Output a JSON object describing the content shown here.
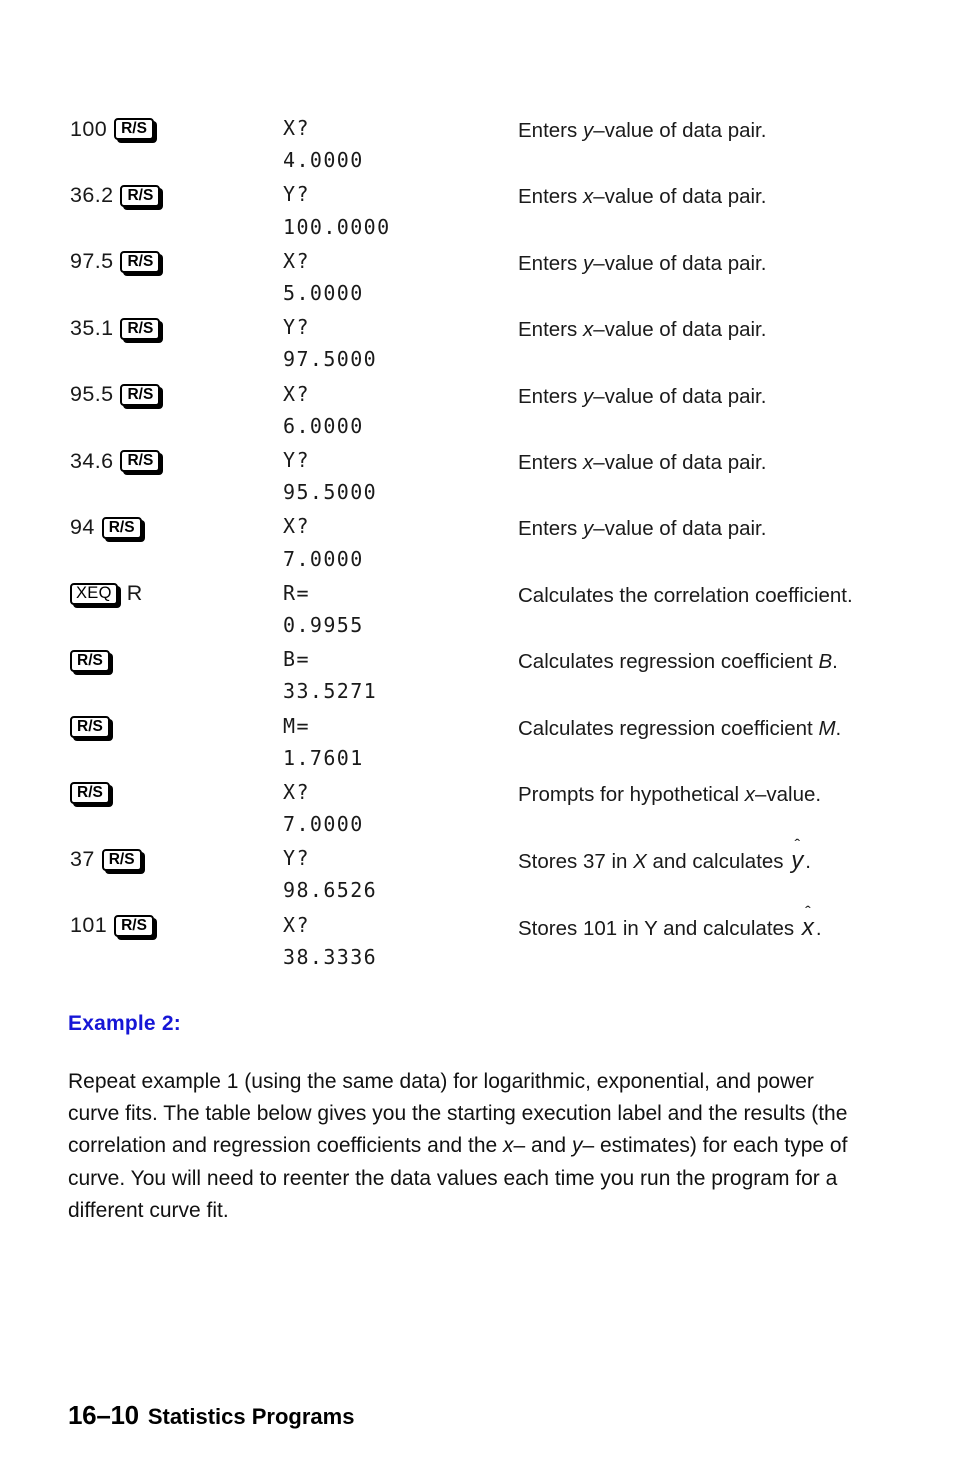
{
  "page": {
    "footer_page_number": "16–10",
    "footer_title": "Statistics Programs"
  },
  "keystroke_table": {
    "rows": [
      {
        "number": "100",
        "key": "R/S",
        "key_style": "bold",
        "suffix": "",
        "display_line1": "X?",
        "display_line2": "4.0000",
        "description_pre": "Enters ",
        "description_var": "y",
        "description_post": "–value of data pair."
      },
      {
        "number": "36.2",
        "key": "R/S",
        "key_style": "bold",
        "suffix": "",
        "display_line1": "Y?",
        "display_line2": "100.0000",
        "description_pre": "Enters ",
        "description_var": "x",
        "description_post": "–value of data pair."
      },
      {
        "number": "97.5",
        "key": "R/S",
        "key_style": "bold",
        "suffix": "",
        "display_line1": "X?",
        "display_line2": "5.0000",
        "description_pre": "Enters ",
        "description_var": "y",
        "description_post": "–value of data pair."
      },
      {
        "number": "35.1",
        "key": "R/S",
        "key_style": "bold",
        "suffix": "",
        "display_line1": "Y?",
        "display_line2": "97.5000",
        "description_pre": "Enters ",
        "description_var": "x",
        "description_post": "–value of data pair."
      },
      {
        "number": "95.5",
        "key": "R/S",
        "key_style": "bold",
        "suffix": "",
        "display_line1": "X?",
        "display_line2": "6.0000",
        "description_pre": "Enters ",
        "description_var": "y",
        "description_post": "–value of data pair."
      },
      {
        "number": "34.6",
        "key": "R/S",
        "key_style": "bold",
        "suffix": "",
        "display_line1": "Y?",
        "display_line2": "95.5000",
        "description_pre": "Enters ",
        "description_var": "x",
        "description_post": "–value of data pair."
      },
      {
        "number": "94",
        "key": "R/S",
        "key_style": "bold",
        "suffix": "",
        "display_line1": "X?",
        "display_line2": "7.0000",
        "description_pre": "Enters ",
        "description_var": "y",
        "description_post": "–value of data pair."
      },
      {
        "number": "",
        "key": "XEQ",
        "key_style": "light",
        "suffix": "R",
        "display_line1": "R=",
        "display_line2": "0.9955",
        "description_pre": "Calculates the correlation coefficient.",
        "description_var": "",
        "description_post": ""
      },
      {
        "number": "",
        "key": "R/S",
        "key_style": "bold",
        "suffix": "",
        "display_line1": "B=",
        "display_line2": "33.5271",
        "description_pre": "Calculates regression coefficient ",
        "description_var": "B",
        "description_post": "."
      },
      {
        "number": "",
        "key": "R/S",
        "key_style": "bold",
        "suffix": "",
        "display_line1": "M=",
        "display_line2": "1.7601",
        "description_pre": "Calculates regression coefficient ",
        "description_var": "M",
        "description_post": "."
      },
      {
        "number": "",
        "key": "R/S",
        "key_style": "bold",
        "suffix": "",
        "display_line1": "X?",
        "display_line2": "7.0000",
        "description_pre": "Prompts for hypothetical ",
        "description_var": "x",
        "description_post": "–value."
      },
      {
        "number": "37",
        "key": "R/S",
        "key_style": "bold",
        "suffix": "",
        "display_line1": "Y?",
        "display_line2": "98.6526",
        "description_pre": "Stores 37 in ",
        "description_var": "X",
        "description_post": " and calculates ",
        "description_hat": "y",
        "description_tail": "."
      },
      {
        "number": "101",
        "key": "R/S",
        "key_style": "bold",
        "suffix": "",
        "display_line1": "X?",
        "display_line2": "38.3336",
        "description_pre": "Stores 101 in Y and calculates ",
        "description_var": "",
        "description_post": "",
        "description_hat": "x",
        "description_tail": "."
      }
    ]
  },
  "example": {
    "heading": "Example 2:",
    "heading_color": "#1616d6",
    "paragraph_part1": "Repeat example 1 (using the same data) for logarithmic, exponential, and power curve fits. The table below gives you the starting execution label and the results (the correlation and regression coefficients and the ",
    "paragraph_var1": "x",
    "paragraph_part2": "– and ",
    "paragraph_var2": "y",
    "paragraph_part3": "– estimates) for each type of curve. You will need to reenter the data values each time you run the program for a different curve fit."
  }
}
